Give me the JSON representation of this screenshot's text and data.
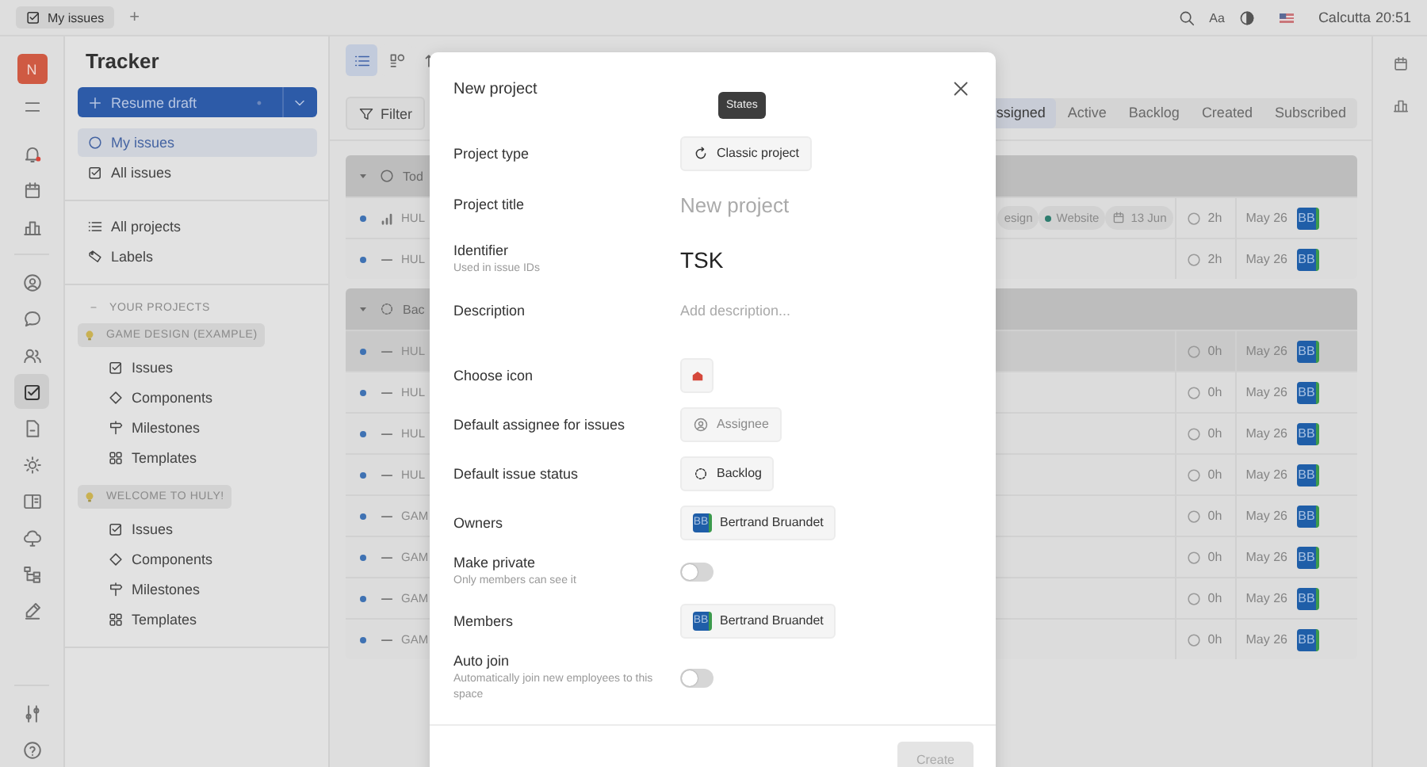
{
  "top_bar": {
    "tabs": [
      {
        "label": "My issues",
        "selected": true
      }
    ],
    "add": "+",
    "font_button": "Aa",
    "location": "Calcutta",
    "time": "20:51"
  },
  "rail": {
    "avatar": "N",
    "top": [
      {
        "selected": false
      }
    ],
    "main": [
      {
        "selected": false
      },
      {
        "selected": false
      },
      {
        "selected": false
      }
    ],
    "apps": [
      {
        "selected": false
      },
      {
        "selected": false
      },
      {
        "selected": false
      },
      {
        "selected": true
      },
      {
        "selected": false
      },
      {
        "selected": false
      },
      {
        "selected": false
      },
      {
        "selected": false
      },
      {
        "selected": false
      },
      {
        "selected": false
      }
    ],
    "bottom": [
      {
        "selected": false
      },
      {
        "selected": false
      }
    ]
  },
  "sidebar": {
    "title": "Tracker",
    "draft_button": "Resume draft",
    "draft_badge": "•",
    "nav": [
      {
        "label": "My issues",
        "selected": true
      },
      {
        "label": "All issues",
        "selected": false
      }
    ],
    "nav2": [
      {
        "label": "All projects",
        "selected": false
      },
      {
        "label": "Labels",
        "selected": false
      }
    ],
    "section": "YOUR PROJECTS",
    "projects": [
      {
        "name": "GAME DESIGN (EXAMPLE)",
        "children": [
          {
            "label": "Issues",
            "selected": false
          },
          {
            "label": "Components",
            "selected": false
          },
          {
            "label": "Milestones",
            "selected": false
          },
          {
            "label": "Templates",
            "selected": false
          }
        ]
      },
      {
        "name": "WELCOME TO HULY!",
        "children": [
          {
            "label": "Issues",
            "selected": false
          },
          {
            "label": "Components",
            "selected": false
          },
          {
            "label": "Milestones",
            "selected": false
          },
          {
            "label": "Templates",
            "selected": false
          }
        ]
      }
    ]
  },
  "toolbar": {
    "views": [
      {
        "selected": true
      },
      {
        "selected": false
      },
      {
        "selected": false
      }
    ],
    "filter": "Filter",
    "tabs": [
      {
        "label": "ssigned",
        "selected": true
      },
      {
        "label": "Active",
        "selected": false
      },
      {
        "label": "Backlog",
        "selected": false
      },
      {
        "label": "Created",
        "selected": false
      },
      {
        "label": "Subscribed",
        "selected": false
      }
    ]
  },
  "groups": [
    {
      "status": "Tod",
      "kind": "todo",
      "rows": [
        {
          "kind": "prioritized",
          "id": "HUL",
          "highlighted": false,
          "tags": [
            {
              "label": "esign"
            },
            {
              "label": "Website",
              "color": "#2e7d6f"
            }
          ],
          "due": "13 Jun",
          "estimate": "2h",
          "date": "May 26",
          "avatar": "BB"
        },
        {
          "kind": "plain",
          "id": "HUL",
          "highlighted": false,
          "estimate": "2h",
          "date": "May 26",
          "avatar": "BB"
        }
      ]
    },
    {
      "status": "Bac",
      "kind": "backlog",
      "rows": [
        {
          "kind": "plain",
          "id": "HUL",
          "highlighted": true,
          "estimate": "0h",
          "date": "May 26",
          "avatar": "BB"
        },
        {
          "kind": "plain",
          "id": "HUL",
          "highlighted": false,
          "estimate": "0h",
          "date": "May 26",
          "avatar": "BB"
        },
        {
          "kind": "plain",
          "id": "HUL",
          "highlighted": false,
          "estimate": "0h",
          "date": "May 26",
          "avatar": "BB"
        },
        {
          "kind": "plain",
          "id": "HUL",
          "highlighted": false,
          "estimate": "0h",
          "date": "May 26",
          "avatar": "BB"
        },
        {
          "kind": "plain",
          "id": "GAM",
          "highlighted": false,
          "estimate": "0h",
          "date": "May 26",
          "avatar": "BB"
        },
        {
          "kind": "plain",
          "id": "GAM",
          "highlighted": false,
          "estimate": "0h",
          "date": "May 26",
          "avatar": "BB"
        },
        {
          "kind": "plain",
          "id": "GAM",
          "highlighted": false,
          "estimate": "0h",
          "date": "May 26",
          "avatar": "BB"
        },
        {
          "kind": "plain",
          "id": "GAM",
          "highlighted": false,
          "estimate": "0h",
          "date": "May 26",
          "avatar": "BB"
        }
      ]
    }
  ],
  "modal": {
    "title": "New project",
    "tooltip": "States",
    "fields": [
      {
        "kind": "button",
        "label": "Project type",
        "value": "Classic project"
      },
      {
        "kind": "title",
        "label": "Project title",
        "placeholder": "New project"
      },
      {
        "kind": "identifier",
        "label": "Identifier",
        "hint": "Used in issue IDs",
        "value": "TSK"
      },
      {
        "kind": "textarea",
        "label": "Description",
        "placeholder": "Add description..."
      },
      {
        "kind": "icon",
        "label": "Choose icon"
      },
      {
        "kind": "button",
        "label": "Default assignee for issues",
        "placeholder": "Assignee"
      },
      {
        "kind": "button",
        "label": "Default issue status",
        "value": "Backlog"
      },
      {
        "kind": "person",
        "label": "Owners",
        "avatar": "BB",
        "value": "Bertrand Bruandet"
      },
      {
        "kind": "toggle",
        "label": "Make private",
        "hint": "Only members can see it",
        "on": false
      },
      {
        "kind": "person",
        "label": "Members",
        "avatar": "BB",
        "value": "Bertrand Bruandet"
      },
      {
        "kind": "toggle",
        "label": "Auto join",
        "hint": "Automatically join new employees to this space",
        "on": false
      }
    ],
    "create": {
      "label": "Create",
      "disabled": true
    }
  }
}
